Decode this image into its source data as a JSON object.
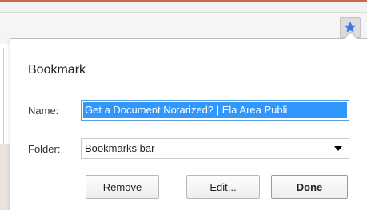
{
  "browser": {
    "toolbar": {
      "bookmark_star_icon": "star-icon",
      "star_color": "#3b78e7"
    }
  },
  "bookmark_bubble": {
    "title": "Bookmark",
    "name_label": "Name:",
    "name_value": "Get a Document Notarized? | Ela Area Publi",
    "folder_label": "Folder:",
    "folder_value": "Bookmarks bar",
    "buttons": {
      "remove": "Remove",
      "edit": "Edit...",
      "done": "Done"
    },
    "colors": {
      "selection": "#3297fd",
      "input_focus_border": "#5a9ee0"
    }
  }
}
